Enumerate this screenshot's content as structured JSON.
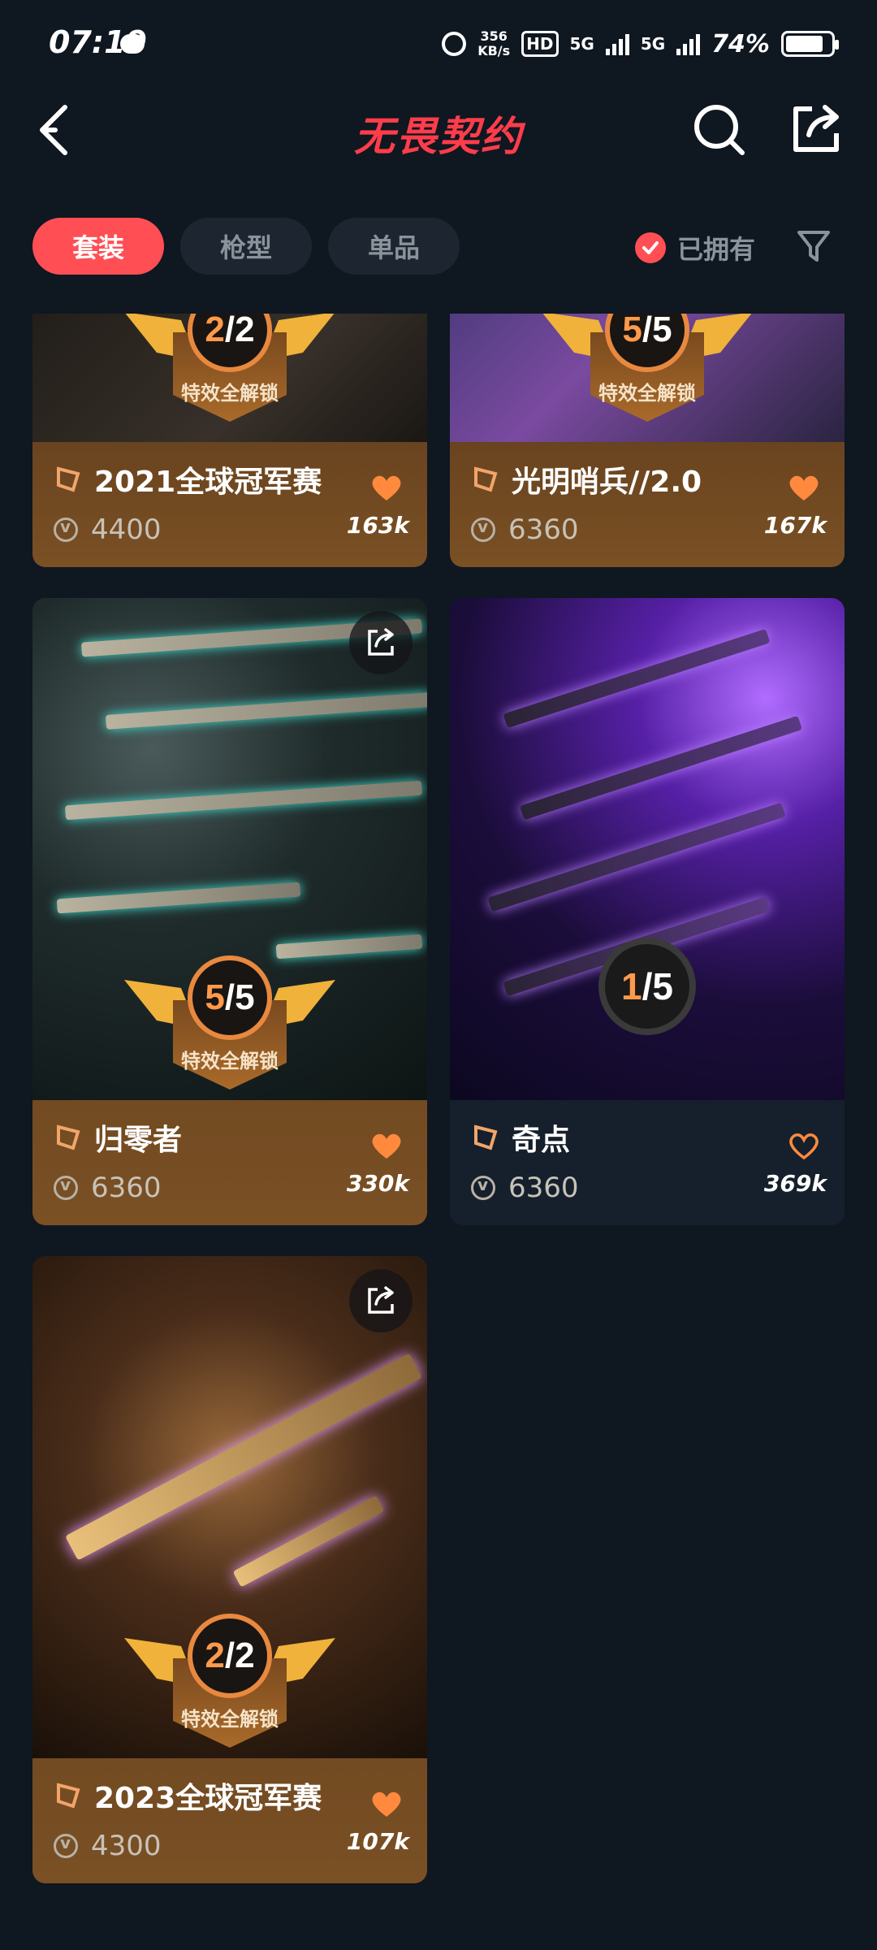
{
  "status_bar": {
    "time": "07:19",
    "speed_value": "356",
    "speed_unit": "KB/s",
    "hd": "HD",
    "sig1": "5G",
    "sig2": "5G",
    "battery": "74%"
  },
  "header": {
    "title": "无畏契约"
  },
  "tabs": [
    {
      "label": "套装",
      "active": true
    },
    {
      "label": "枪型",
      "active": false
    },
    {
      "label": "单品",
      "active": false
    }
  ],
  "owned_filter_label": "已拥有",
  "badge_unlock_text": "特效全解锁",
  "cards": [
    {
      "name": "2021全球冠军赛",
      "price": "4400",
      "likes": "163k",
      "progress": "2",
      "total": "2",
      "liked": true
    },
    {
      "name": "光明哨兵//2.0",
      "price": "6360",
      "likes": "167k",
      "progress": "5",
      "total": "5",
      "liked": true
    },
    {
      "name": "归零者",
      "price": "6360",
      "likes": "330k",
      "progress": "5",
      "total": "5",
      "liked": true
    },
    {
      "name": "奇点",
      "price": "6360",
      "likes": "369k",
      "progress": "1",
      "total": "5",
      "liked": false
    },
    {
      "name": "2023全球冠军赛",
      "price": "4300",
      "likes": "107k",
      "progress": "2",
      "total": "2",
      "liked": true
    }
  ],
  "colors": {
    "accent": "#ff4f55",
    "background": "#0f1721",
    "heart": "#ff8a3d"
  }
}
